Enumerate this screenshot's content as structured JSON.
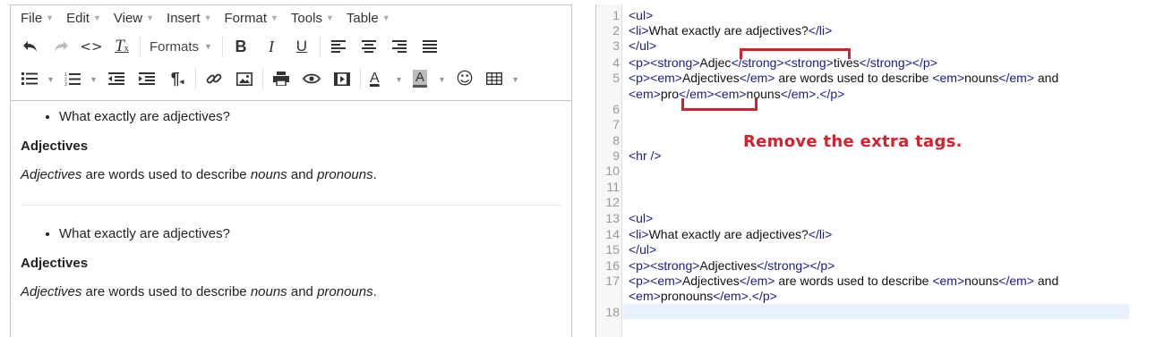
{
  "menubar": {
    "items": [
      "File",
      "Edit",
      "View",
      "Insert",
      "Format",
      "Tools",
      "Table"
    ]
  },
  "toolbar": {
    "formats_label": "Formats",
    "row1_icons": [
      "undo-icon",
      "redo-icon",
      "code-icon",
      "clear-format-icon",
      "bold-icon",
      "italic-icon",
      "underline-icon",
      "align-left-icon",
      "align-center-icon",
      "align-right-icon",
      "align-justify-icon"
    ],
    "row2_icons": [
      "bullet-list-icon",
      "numbered-list-icon",
      "outdent-icon",
      "indent-icon",
      "paragraph-icon",
      "link-icon",
      "image-icon",
      "print-icon",
      "preview-icon",
      "media-icon",
      "text-color-icon",
      "background-color-icon",
      "emoticon-icon",
      "table-icon"
    ]
  },
  "preview": {
    "block1": {
      "list_item": "What exactly are adjectives?",
      "heading": "Adjectives",
      "para": {
        "em1": "Adjectives",
        "t1": " are words used to describe ",
        "em2": "nouns",
        "t2": " and ",
        "em3": "pronouns",
        "t3": "."
      }
    },
    "block2": {
      "list_item": "What exactly are adjectives?",
      "heading": "Adjectives",
      "para": {
        "em1": "Adjectives",
        "t1": " are words used to describe ",
        "em2": "nouns",
        "t2": " and ",
        "em3": "pronouns",
        "t3": "."
      }
    }
  },
  "code": {
    "line_numbers": [
      "1",
      "2",
      "3",
      "4",
      "5",
      "",
      "6",
      "7",
      "8",
      "9",
      "10",
      "11",
      "12",
      "13",
      "14",
      "15",
      "16",
      "17",
      "",
      "18"
    ],
    "lines": {
      "l1": [
        {
          "k": "tag",
          "v": "<ul>"
        }
      ],
      "l2": [
        {
          "k": "tag",
          "v": "<li>"
        },
        {
          "k": "txt",
          "v": "What exactly are adjectives?"
        },
        {
          "k": "tag",
          "v": "</li>"
        }
      ],
      "l3": [
        {
          "k": "tag",
          "v": "</ul>"
        }
      ],
      "l4": [
        {
          "k": "tag",
          "v": "<p><strong>"
        },
        {
          "k": "txt",
          "v": "Adjec"
        },
        {
          "k": "tag",
          "v": "</strong><strong>"
        },
        {
          "k": "txt",
          "v": "tives"
        },
        {
          "k": "tag",
          "v": "</strong></p>"
        }
      ],
      "l5a": [
        {
          "k": "tag",
          "v": "<p><em>"
        },
        {
          "k": "txt",
          "v": "Adjectives"
        },
        {
          "k": "tag",
          "v": "</em>"
        },
        {
          "k": "txt",
          "v": " are words used to describe "
        },
        {
          "k": "tag",
          "v": "<em>"
        },
        {
          "k": "txt",
          "v": "nouns"
        },
        {
          "k": "tag",
          "v": "</em>"
        },
        {
          "k": "txt",
          "v": " and"
        }
      ],
      "l5b": [
        {
          "k": "tag",
          "v": "<em>"
        },
        {
          "k": "txt",
          "v": "pro"
        },
        {
          "k": "tag",
          "v": "</em><em>"
        },
        {
          "k": "txt",
          "v": "nouns"
        },
        {
          "k": "tag",
          "v": "</em>"
        },
        {
          "k": "txt",
          "v": "."
        },
        {
          "k": "tag",
          "v": "</p>"
        }
      ],
      "l9": [
        {
          "k": "tag",
          "v": "<hr />"
        }
      ],
      "l13": [
        {
          "k": "tag",
          "v": "<ul>"
        }
      ],
      "l14": [
        {
          "k": "tag",
          "v": "<li>"
        },
        {
          "k": "txt",
          "v": "What exactly are adjectives?"
        },
        {
          "k": "tag",
          "v": "</li>"
        }
      ],
      "l15": [
        {
          "k": "tag",
          "v": "</ul>"
        }
      ],
      "l16": [
        {
          "k": "tag",
          "v": "<p><strong>"
        },
        {
          "k": "txt",
          "v": "Adjectives"
        },
        {
          "k": "tag",
          "v": "</strong></p>"
        }
      ],
      "l17a": [
        {
          "k": "tag",
          "v": "<p><em>"
        },
        {
          "k": "txt",
          "v": "Adjectives"
        },
        {
          "k": "tag",
          "v": "</em>"
        },
        {
          "k": "txt",
          "v": " are words used to describe "
        },
        {
          "k": "tag",
          "v": "<em>"
        },
        {
          "k": "txt",
          "v": "nouns"
        },
        {
          "k": "tag",
          "v": "</em>"
        },
        {
          "k": "txt",
          "v": " and"
        }
      ],
      "l17b": [
        {
          "k": "tag",
          "v": "<em>"
        },
        {
          "k": "txt",
          "v": "pronouns"
        },
        {
          "k": "tag",
          "v": "</em>"
        },
        {
          "k": "txt",
          "v": "."
        },
        {
          "k": "tag",
          "v": "</p>"
        }
      ]
    }
  },
  "annotation": {
    "note": "Remove the extra tags.",
    "color": "#d3212e"
  },
  "colors": {
    "tag": "#1a1a8c",
    "gutter_bg": "#f7f7f7",
    "active_line": "#e8f2ff"
  }
}
